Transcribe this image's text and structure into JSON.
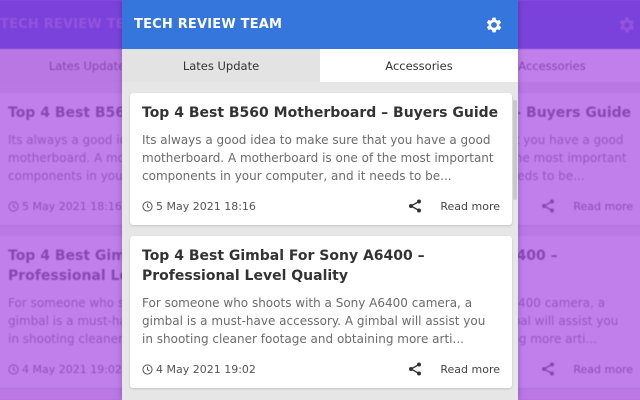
{
  "header": {
    "title": "TECH REVIEW TEAM",
    "settings_icon": "gear-icon"
  },
  "tabs": [
    {
      "label": "Lates Update",
      "active": true
    },
    {
      "label": "Accessories",
      "active": false
    }
  ],
  "posts": [
    {
      "title": "Top 4 Best B560 Motherboard – Buyers Guide",
      "excerpt": "Its always a good idea to make sure that you have a good motherboard. A motherboard is one of the most important components in your computer, and it needs to be...",
      "date": "5 May 2021 18:16",
      "read_more": "Read more"
    },
    {
      "title": "Top 4 Best Gimbal For Sony A6400 – Professional Level Quality",
      "excerpt": "For someone who shoots with a Sony A6400 camera, a gimbal is a must-have accessory. A gimbal will assist you in shooting cleaner footage and obtaining more arti...",
      "date": "4 May 2021 19:02",
      "read_more": "Read more"
    }
  ],
  "colors": {
    "header": "#3576dd",
    "background_tint": "#a94de3"
  }
}
